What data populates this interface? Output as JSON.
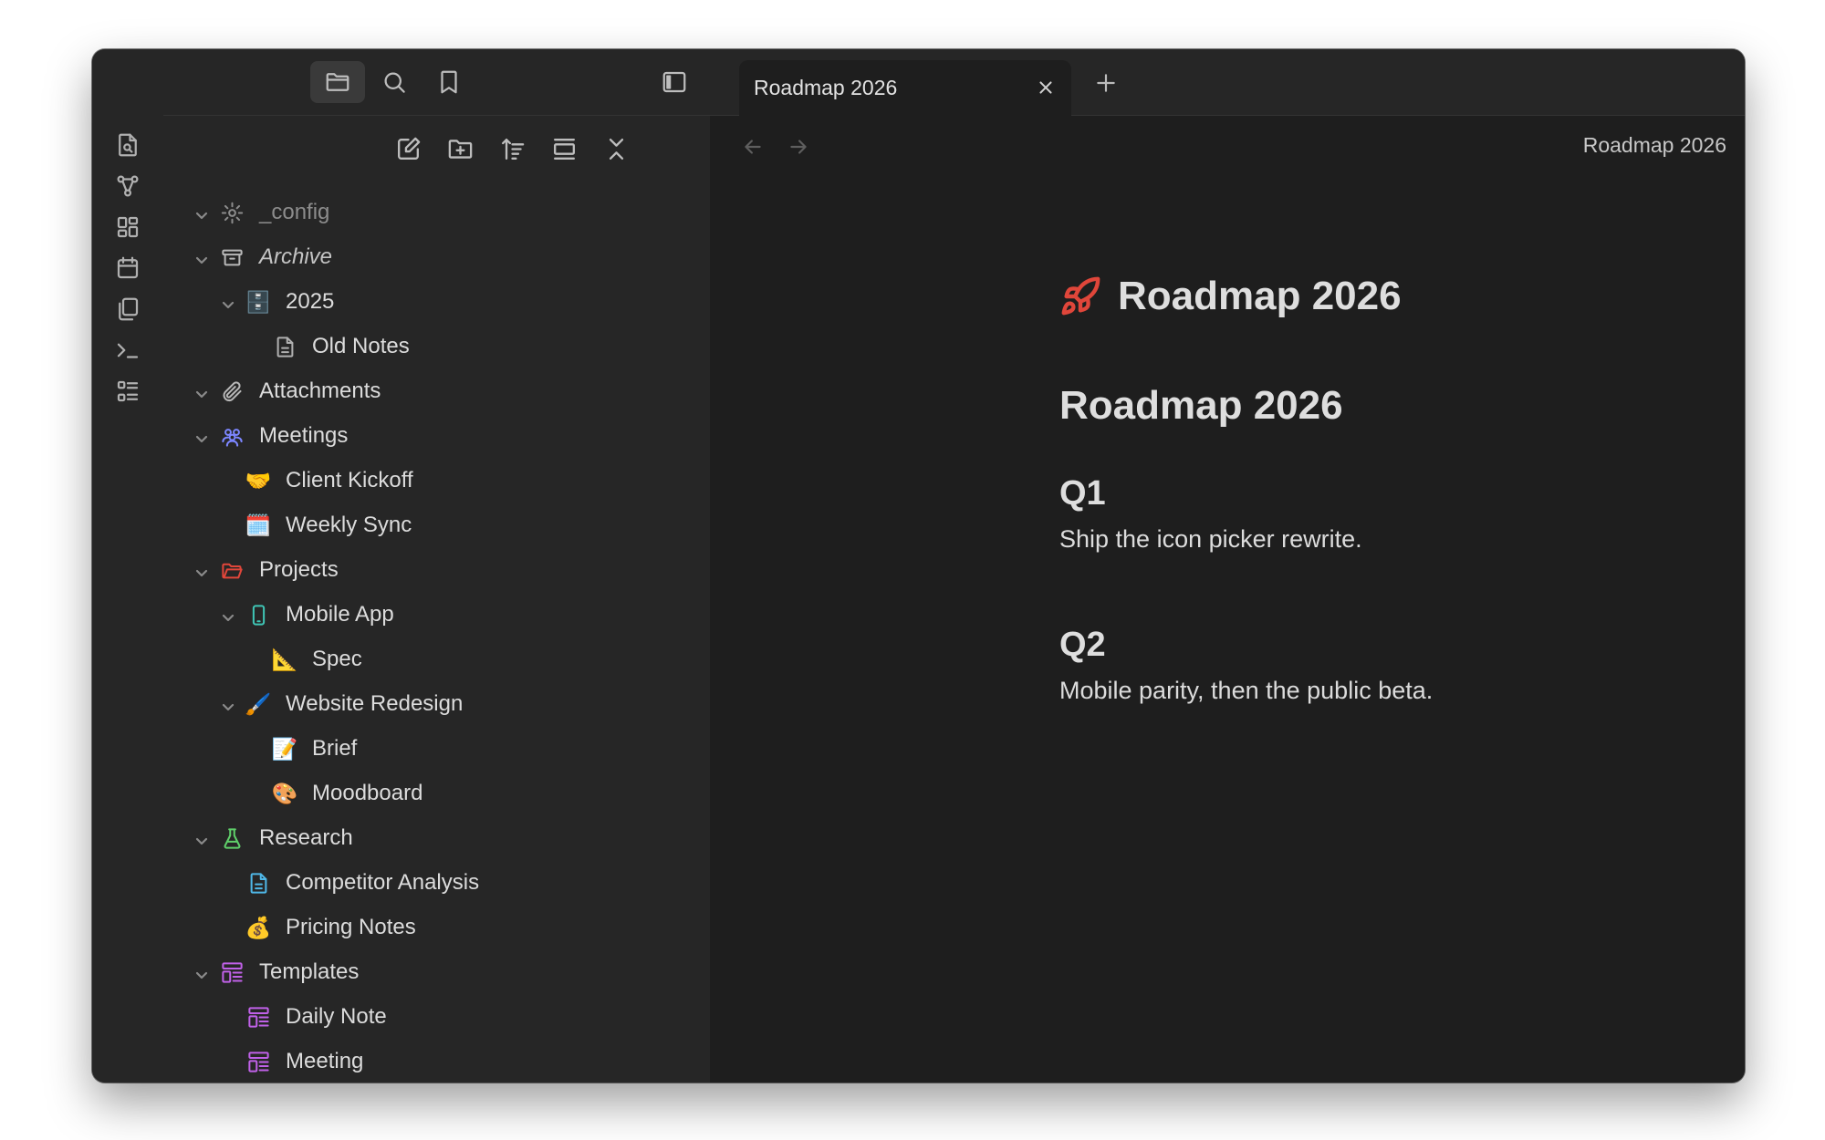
{
  "sidebar_tabs": {
    "files": "folder-icon",
    "search": "search-icon",
    "bookmarks": "bookmark-icon"
  },
  "tree": [
    {
      "label": "_config",
      "icon": "gear-icon",
      "expanded": true
    },
    {
      "label": "Archive",
      "icon": "archive-box-icon",
      "expanded": true
    },
    {
      "label": "2025",
      "icon": "file-cabinet-emoji",
      "expanded": true
    },
    {
      "label": "Old Notes",
      "icon": "document-icon"
    },
    {
      "label": "Attachments",
      "icon": "paperclip-icon",
      "expanded": true
    },
    {
      "label": "Meetings",
      "icon": "people-icon",
      "expanded": true
    },
    {
      "label": "Client Kickoff",
      "icon": "handshake-emoji"
    },
    {
      "label": "Weekly Sync",
      "icon": "calendar-emoji"
    },
    {
      "label": "Projects",
      "icon": "folder-icon",
      "expanded": true
    },
    {
      "label": "Mobile App",
      "icon": "phone-icon",
      "expanded": true
    },
    {
      "label": "Spec",
      "icon": "triangle-ruler-emoji"
    },
    {
      "label": "Website Redesign",
      "icon": "paintbrush-emoji",
      "expanded": true
    },
    {
      "label": "Brief",
      "icon": "memo-emoji"
    },
    {
      "label": "Moodboard",
      "icon": "palette-emoji"
    },
    {
      "label": "Research",
      "icon": "flask-icon",
      "expanded": true
    },
    {
      "label": "Competitor Analysis",
      "icon": "document-icon"
    },
    {
      "label": "Pricing Notes",
      "icon": "money-bag-emoji"
    },
    {
      "label": "Templates",
      "icon": "template-icon",
      "expanded": true
    },
    {
      "label": "Daily Note",
      "icon": "template-icon"
    },
    {
      "label": "Meeting",
      "icon": "template-icon"
    }
  ],
  "tab": {
    "title": "Roadmap 2026"
  },
  "view_header": {
    "title": "Roadmap 2026"
  },
  "doc": {
    "title": "Roadmap 2026",
    "title_icon": "rocket-icon",
    "heading": "Roadmap 2026",
    "sections": [
      {
        "heading": "Q1",
        "text": "Ship the icon picker rewrite."
      },
      {
        "heading": "Q2",
        "text": "Mobile parity, then the public beta."
      }
    ]
  },
  "colors": {
    "rocket": "#e0463a",
    "projects_folder": "#e0463a",
    "meetings": "#7c86ff",
    "mobile_app": "#3fc5b5",
    "research": "#5fcf6a",
    "competitor_doc": "#4fb8e8",
    "templates": "#c061e8"
  }
}
